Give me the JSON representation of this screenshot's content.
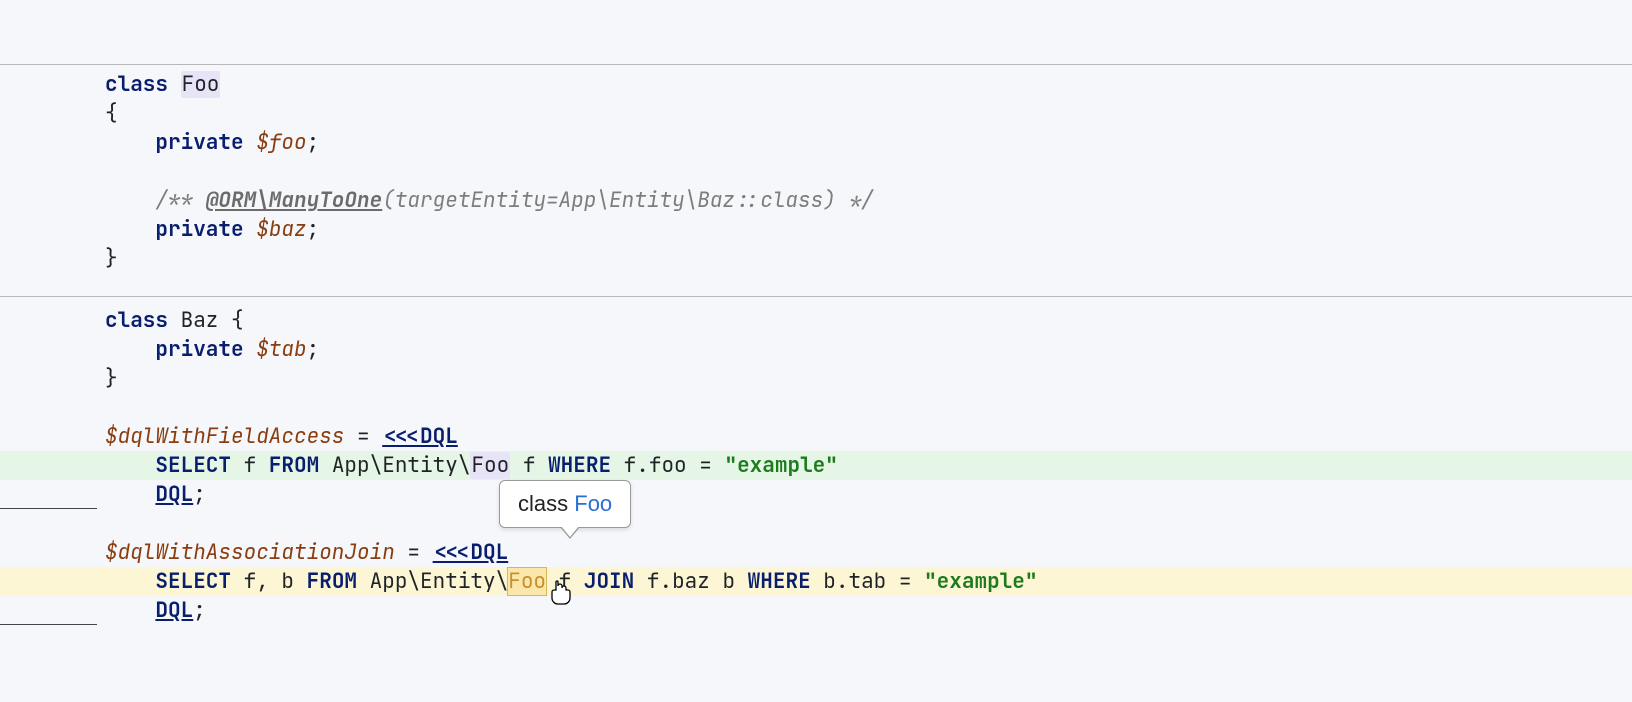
{
  "colors": {
    "bg": "#f5f7fb",
    "keyword": "#0a1e6e",
    "variable": "#8a3d0f",
    "comment": "#7d7d7d",
    "string": "#1d7b1d",
    "hlGreen": "#e6f6e6",
    "hlYellow": "#fcf6d4",
    "tooltipName": "#2b6ed4"
  },
  "code": {
    "foo_class": {
      "l1_kw": "class",
      "l1_name": "Foo",
      "l2": "{",
      "l3_kw": "private",
      "l3_var": "$foo",
      "l3_semi": ";",
      "l4_open": "/** ",
      "l4_ann": "@ORM\\ManyToOne",
      "l4_rest": "(targetEntity=App\\Entity\\Baz::class) */",
      "l5_kw": "private",
      "l5_var": "$baz",
      "l5_semi": ";",
      "l6": "}"
    },
    "baz_class": {
      "l1_kw": "class",
      "l1_name": "Baz",
      "l1_brace": " {",
      "l2_kw": "private",
      "l2_var": "$tab",
      "l2_semi": ";",
      "l3": "}"
    },
    "dql1": {
      "assign_var": "$dqlWithFieldAccess",
      "assign_eq": " = ",
      "heredoc_open": "<<<DQL",
      "q_select": "SELECT",
      "q_f": " f ",
      "q_from": "FROM",
      "q_ent_pre": " App\\Entity\\",
      "q_ent_foo": "Foo",
      "q_alias": " f ",
      "q_where": "WHERE",
      "q_pred": " f.foo = ",
      "q_str": "\"example\"",
      "heredoc_close": "DQL",
      "close_semi": ";"
    },
    "dql2": {
      "assign_var": "$dqlWithAssociationJoin",
      "assign_eq": " = ",
      "heredoc_open": "<<<DQL",
      "q_select": "SELECT",
      "q_fb": " f, b ",
      "q_from": "FROM",
      "q_ent_pre": " App\\Entity\\",
      "q_ent_foo": "Foo",
      "q_alias": " f ",
      "q_join": "JOIN",
      "q_joinexpr": " f.baz b ",
      "q_where": "WHERE",
      "q_pred": " b.tab = ",
      "q_str": "\"example\"",
      "heredoc_close": "DQL",
      "close_semi": ";"
    }
  },
  "tooltip": {
    "kw": "class ",
    "name": "Foo"
  },
  "icons": {
    "cursor": "link-pointer-icon"
  }
}
